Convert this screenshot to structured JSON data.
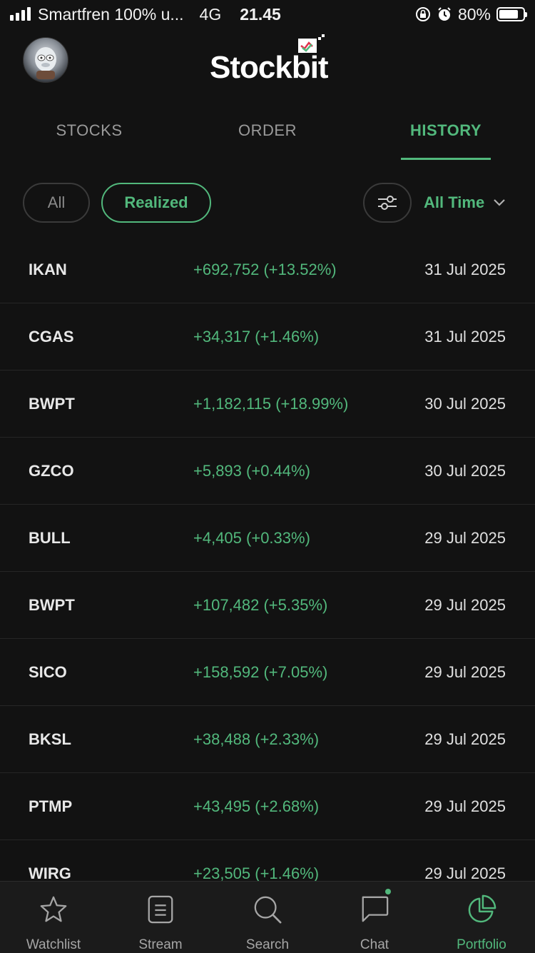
{
  "status_bar": {
    "carrier": "Smartfren 100% u...",
    "network": "4G",
    "time": "21.45",
    "battery": "80%",
    "battery_level": 0.8
  },
  "header": {
    "logo_text": "Stockbit",
    "logo_mark_colors": [
      "#e0334d",
      "#52b87c",
      "#ffffff"
    ]
  },
  "tabs": [
    {
      "label": "STOCKS",
      "active": false
    },
    {
      "label": "ORDER",
      "active": false
    },
    {
      "label": "HISTORY",
      "active": true
    }
  ],
  "filters": {
    "all_label": "All",
    "realized_label": "Realized",
    "time_label": "All Time",
    "filter_icon": "sliders-icon",
    "dropdown_icon": "chevron-down-icon"
  },
  "history": [
    {
      "symbol": "IKAN",
      "pl": "+692,752 (+13.52%)",
      "date": "31 Jul 2025"
    },
    {
      "symbol": "CGAS",
      "pl": "+34,317 (+1.46%)",
      "date": "31 Jul 2025"
    },
    {
      "symbol": "BWPT",
      "pl": "+1,182,115 (+18.99%)",
      "date": "30 Jul 2025"
    },
    {
      "symbol": "GZCO",
      "pl": "+5,893 (+0.44%)",
      "date": "30 Jul 2025"
    },
    {
      "symbol": "BULL",
      "pl": "+4,405 (+0.33%)",
      "date": "29 Jul 2025"
    },
    {
      "symbol": "BWPT",
      "pl": "+107,482 (+5.35%)",
      "date": "29 Jul 2025"
    },
    {
      "symbol": "SICO",
      "pl": "+158,592 (+7.05%)",
      "date": "29 Jul 2025"
    },
    {
      "symbol": "BKSL",
      "pl": "+38,488 (+2.33%)",
      "date": "29 Jul 2025"
    },
    {
      "symbol": "PTMP",
      "pl": "+43,495 (+2.68%)",
      "date": "29 Jul 2025"
    },
    {
      "symbol": "WIRG",
      "pl": "+23,505 (+1.46%)",
      "date": "29 Jul 2025"
    }
  ],
  "bottom_nav": [
    {
      "label": "Watchlist",
      "icon": "star-icon",
      "active": false
    },
    {
      "label": "Stream",
      "icon": "stream-icon",
      "active": false
    },
    {
      "label": "Search",
      "icon": "search-icon",
      "active": false
    },
    {
      "label": "Chat",
      "icon": "chat-icon",
      "active": false,
      "badge": true
    },
    {
      "label": "Portfolio",
      "icon": "pie-chart-icon",
      "active": true
    }
  ],
  "colors": {
    "accent": "#52b87c",
    "background": "#121212",
    "nav_background": "#1b1b1b"
  }
}
